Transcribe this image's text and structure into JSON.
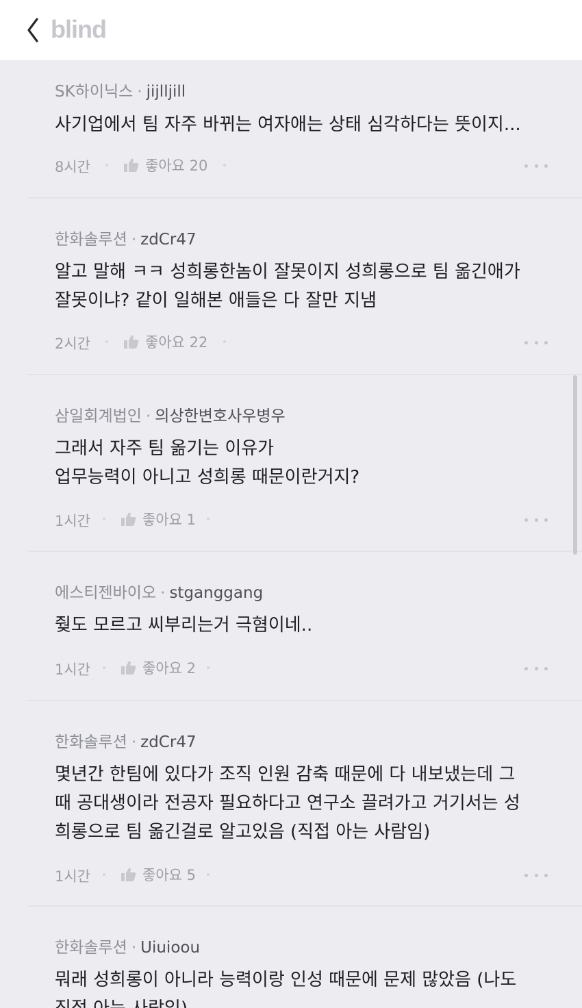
{
  "header": {
    "back_icon": "chevron-left-icon",
    "logo": "blind"
  },
  "comments": [
    {
      "company": "SK하이닉스",
      "nickname": "jijlljill",
      "body": "사기업에서 팀 자주 바뀌는 여자애는 상태 심각하다는 뜻이지...",
      "time": "8시간",
      "like_label": "좋아요 20"
    },
    {
      "company": "한화솔루션",
      "nickname": "zdCr47",
      "body": "알고 말해 ㅋㅋ 성희롱한놈이 잘못이지 성희롱으로 팀 옮긴애가\n잘못이냐? 같이 일해본 애들은 다 잘만 지냄",
      "time": "2시간",
      "like_label": "좋아요 22"
    },
    {
      "company": "삼일회계법인",
      "nickname": "의상한변호사우병우",
      "body": "그래서 자주 팀 옮기는 이유가\n업무능력이 아니고 성희롱 때문이란거지?",
      "time": "1시간",
      "like_label": "좋아요 1"
    },
    {
      "company": "에스티젠바이오",
      "nickname": "stganggang",
      "body": "줮도 모르고 씨부리는거 극혐이네..",
      "time": "1시간",
      "like_label": "좋아요 2"
    },
    {
      "company": "한화솔루션",
      "nickname": "zdCr47",
      "body": "몇년간 한팀에 있다가 조직 인원 감축 때문에 다 내보냈는데 그\n때 공대생이라 전공자 필요하다고 연구소 끌려가고 거기서는 성\n희롱으로 팀 옮긴걸로 알고있음 (직접 아는 사람임)",
      "time": "1시간",
      "like_label": "좋아요 5"
    },
    {
      "company": "한화솔루션",
      "nickname": "Uiuioou",
      "body": "뭐래 성희롱이 아니라 능력이랑 인성 때문에 문제 많았음 (나도\n직접 아는 사람임)",
      "time": "",
      "like_label": ""
    }
  ]
}
